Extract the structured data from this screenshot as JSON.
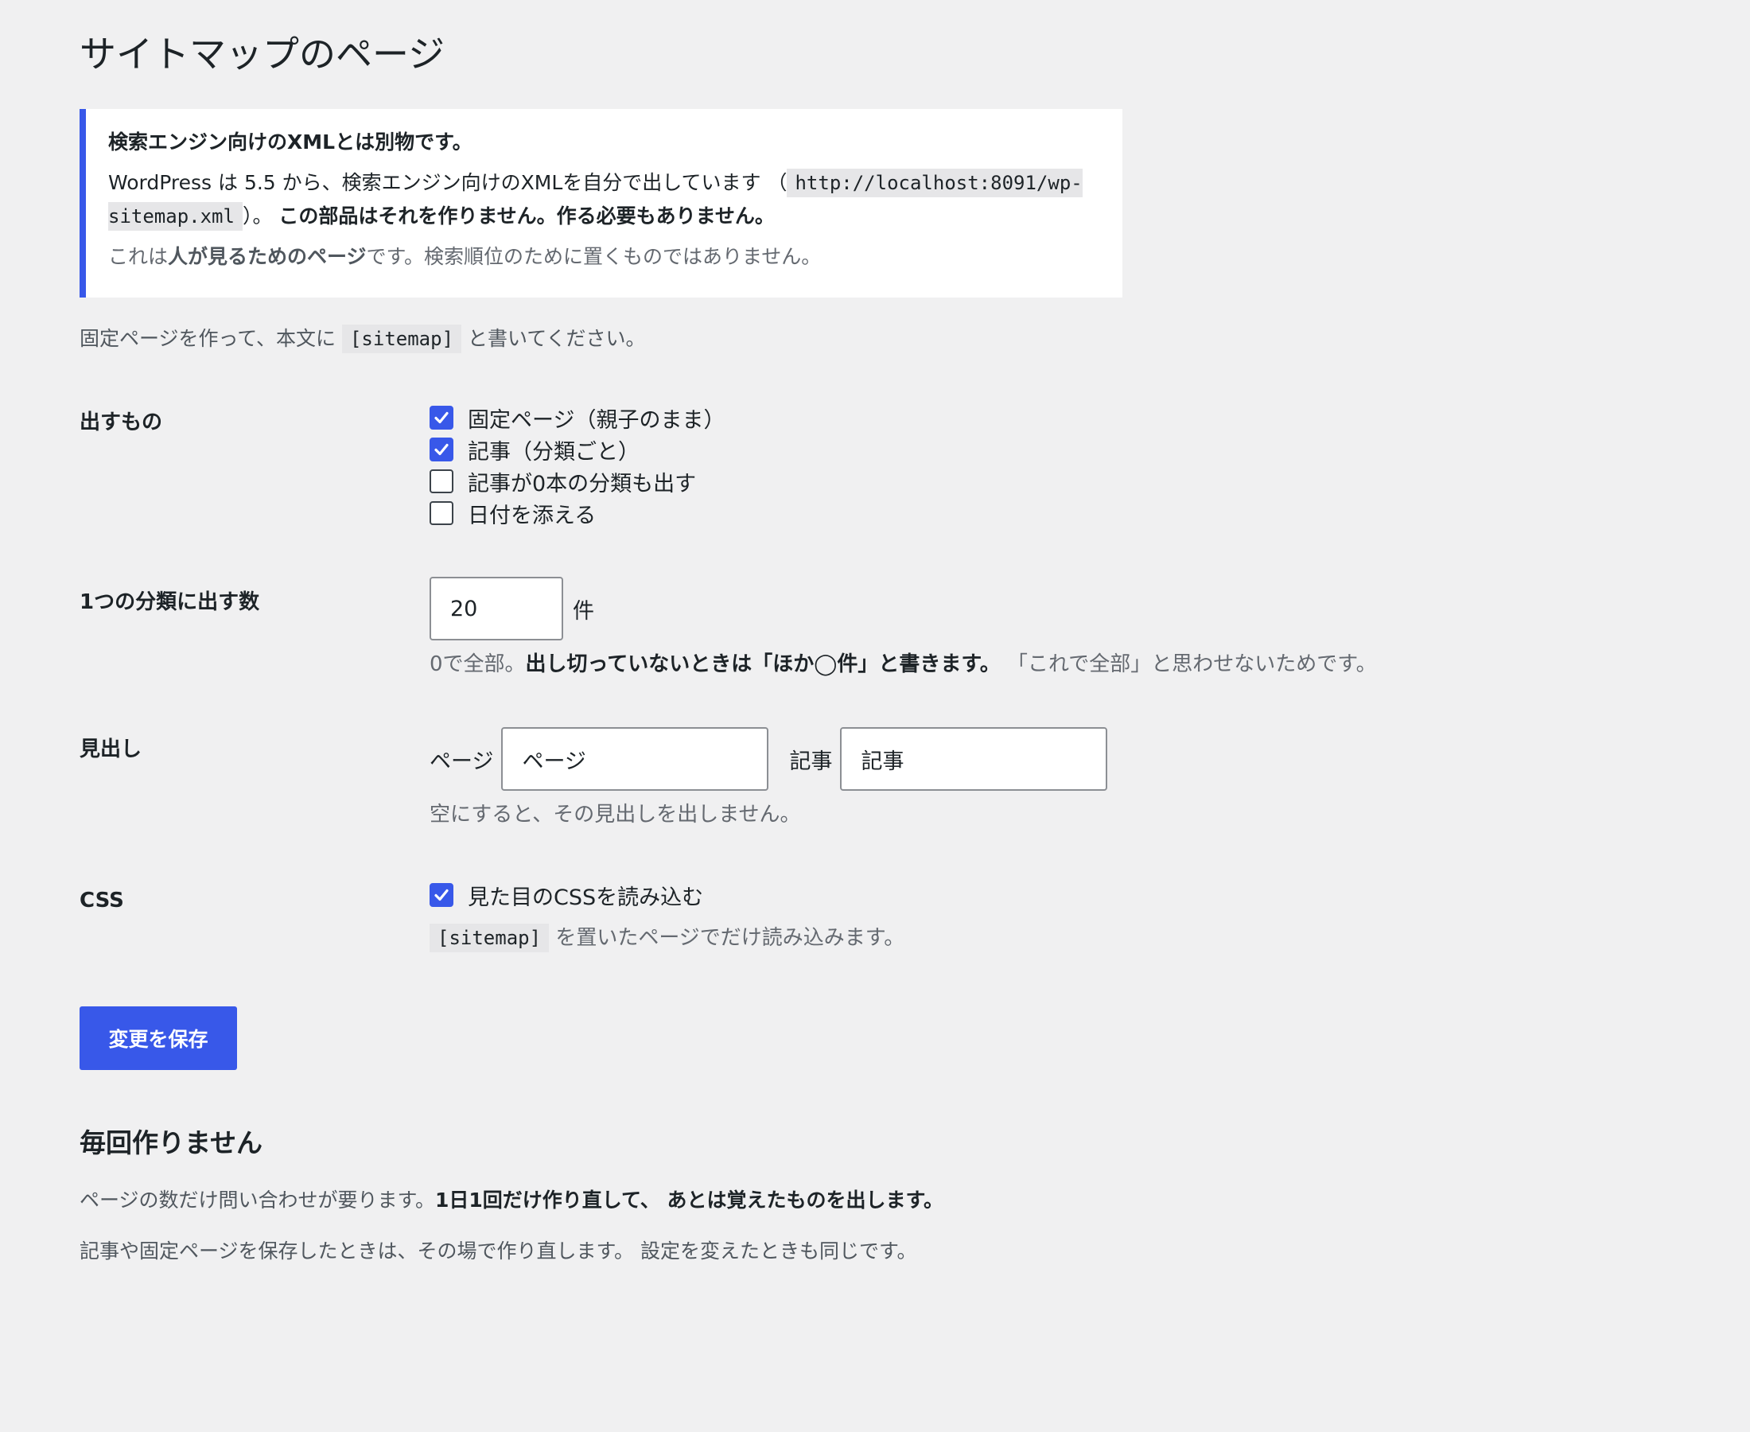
{
  "page_title": "サイトマップのページ",
  "notice": {
    "title": "検索エンジン向けのXMLとは別物です。",
    "body_prefix": "WordPress は 5.5 から、検索エンジン向けのXMLを自分で出しています （",
    "url": "http://localhost:8091/wp-sitemap.xml",
    "body_mid": "）。",
    "body_strong": "この部品はそれを作りません。作る必要もありません。",
    "note_prefix": "これは",
    "note_strong": "人が見るためのページ",
    "note_suffix": "です。検索順位のために置くものではありません。"
  },
  "intro": {
    "prefix": "固定ページを作って、本文に",
    "code": "[sitemap]",
    "suffix": "と書いてください。"
  },
  "output_items": {
    "label": "出すもの",
    "options": [
      {
        "label": "固定ページ（親子のまま）",
        "checked": true
      },
      {
        "label": "記事（分類ごと）",
        "checked": true
      },
      {
        "label": "記事が0本の分類も出す",
        "checked": false
      },
      {
        "label": "日付を添える",
        "checked": false
      }
    ]
  },
  "per_category": {
    "label": "1つの分類に出す数",
    "value": "20",
    "unit": "件",
    "desc_prefix": "0で全部。",
    "desc_strong": "出し切っていないときは「ほか◯件」と書きます。",
    "desc_suffix": "「これで全部」と思わせないためです。"
  },
  "headings": {
    "label": "見出し",
    "page_label": "ページ",
    "page_value": "ページ",
    "post_label": "記事",
    "post_value": "記事",
    "desc": "空にすると、その見出しを出しません。"
  },
  "css": {
    "label": "CSS",
    "checkbox_label": "見た目のCSSを読み込む",
    "checked": true,
    "code": "[sitemap]",
    "desc_suffix": "を置いたページでだけ読み込みます。"
  },
  "save_button": "変更を保存",
  "cache_section": {
    "title": "毎回作りません",
    "p1_prefix": "ページの数だけ問い合わせが要ります。",
    "p1_strong": "1日1回だけ作り直して、 あとは覚えたものを出します。",
    "p2": "記事や固定ページを保存したときは、その場で作り直します。 設定を変えたときも同じです。"
  },
  "colors": {
    "accent": "#3858e9",
    "background": "#f0f0f1"
  }
}
